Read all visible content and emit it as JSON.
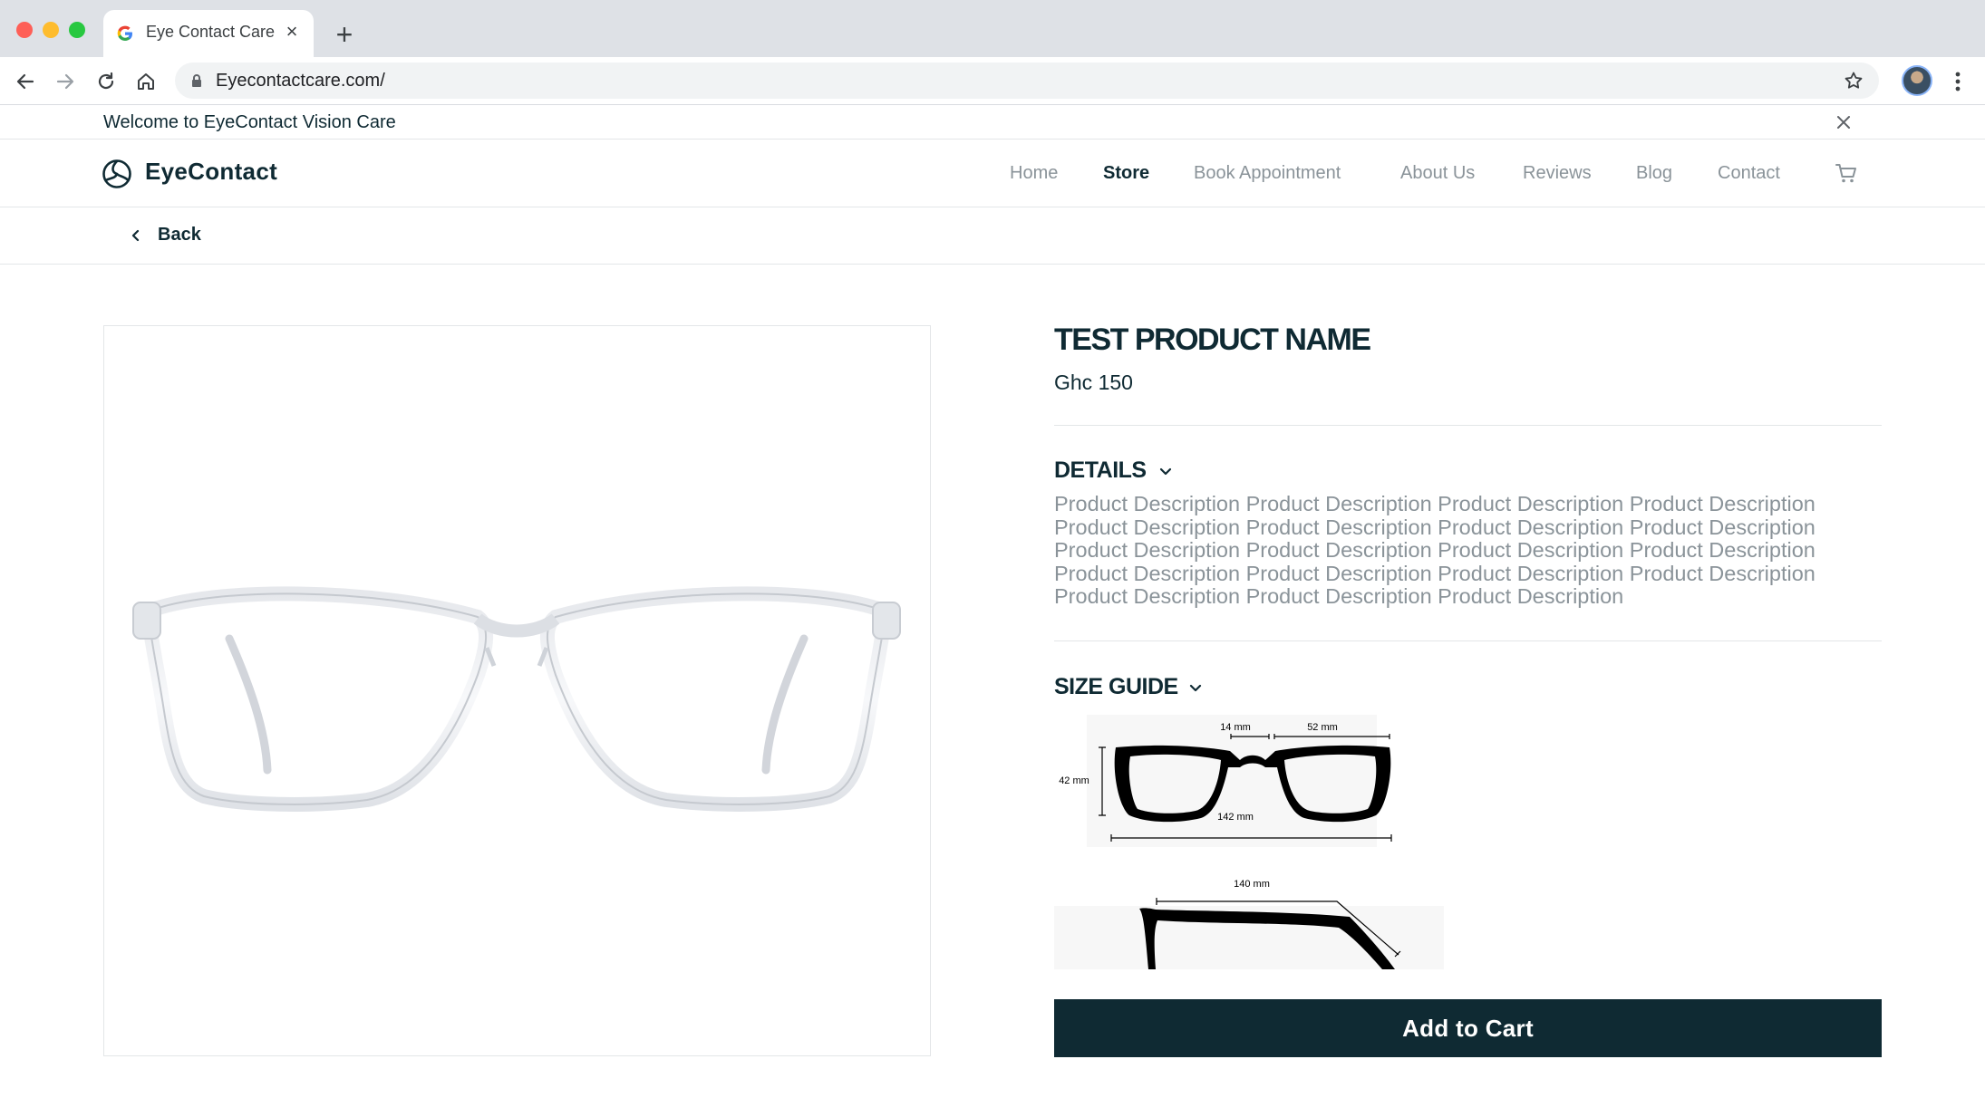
{
  "browser": {
    "tab_title": "Eye Contact Care",
    "url": "Eyecontactcare.com/"
  },
  "site": {
    "welcome_text": "Welcome to EyeContact Vision Care",
    "brand": "EyeContact",
    "nav": [
      {
        "label": "Home",
        "active": false
      },
      {
        "label": "Store",
        "active": true
      },
      {
        "label": "Book Appointment",
        "active": false
      },
      {
        "label": "About Us",
        "active": false
      },
      {
        "label": "Reviews",
        "active": false
      },
      {
        "label": "Blog",
        "active": false
      },
      {
        "label": "Contact",
        "active": false
      }
    ],
    "back_label": "Back"
  },
  "product": {
    "title": "TEST PRODUCT NAME",
    "price": "Ghc 150",
    "details_heading": "DETAILS",
    "description_lines": [
      "Product Description Product Description Product Description Product Description",
      "Product Description Product Description Product Description Product Description",
      "Product Description Product Description Product Description Product Description",
      "Product Description Product Description Product Description Product Description",
      "Product Description Product Description Product Description"
    ],
    "size_guide_heading": "SIZE GUIDE",
    "size_guide": {
      "bridge": "14 mm",
      "lens_width": "52 mm",
      "lens_height": "42 mm",
      "frame_width": "142 mm",
      "temple_length": "140 mm"
    },
    "add_to_cart_label": "Add to Cart"
  },
  "colors": {
    "primary": "#0f2a33",
    "muted_text": "#8a9399",
    "divider": "#e3e6e8"
  },
  "icons": [
    "google-favicon",
    "close-icon",
    "plus-icon",
    "back-arrow-icon",
    "forward-arrow-icon",
    "reload-icon",
    "home-icon",
    "lock-icon",
    "star-icon",
    "kebab-menu-icon",
    "eyecontact-logo-icon",
    "cart-icon",
    "chevron-left-icon",
    "chevron-down-icon"
  ]
}
